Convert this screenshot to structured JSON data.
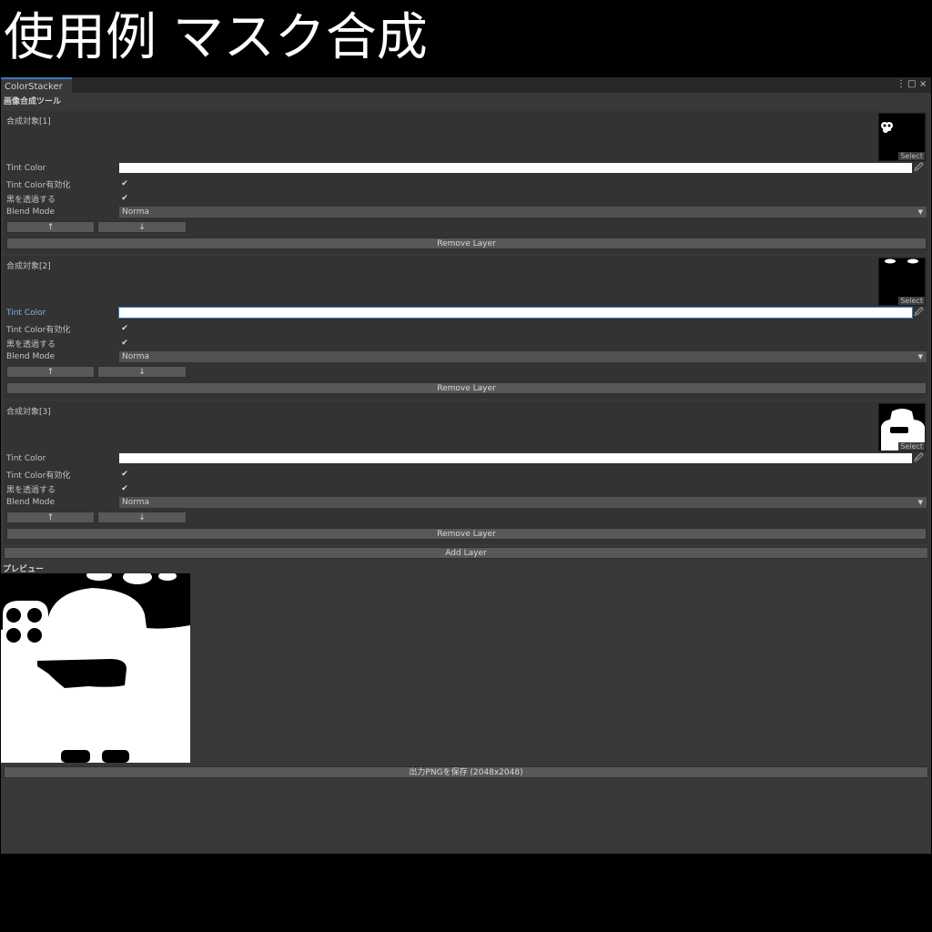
{
  "banner": {
    "title": "使用例 マスク合成"
  },
  "window": {
    "tab_label": "ColorStacker",
    "menu_icon": "⋮",
    "maximize_icon": "□",
    "close_icon": "×"
  },
  "tool_title": "画像合成ツール",
  "labels": {
    "tint_color": "Tint Color",
    "tint_enable": "Tint Color有効化",
    "black_transparent": "黒を透過する",
    "blend_mode": "Blend Mode",
    "select": "Select",
    "up": "↑",
    "down": "↓",
    "remove_layer": "Remove Layer",
    "check": "✔",
    "picker": "🖉",
    "dropdown_arrow": "▼"
  },
  "layers": [
    {
      "title": "合成対象[1]",
      "tint_color": "#ffffff",
      "tint_enabled": true,
      "black_transparent": true,
      "blend_mode": "Norma"
    },
    {
      "title": "合成対象[2]",
      "tint_color": "#ffffff",
      "tint_enabled": true,
      "black_transparent": true,
      "blend_mode": "Norma"
    },
    {
      "title": "合成対象[3]",
      "tint_color": "#ffffff",
      "tint_enabled": true,
      "black_transparent": true,
      "blend_mode": "Norma"
    }
  ],
  "add_layer_label": "Add Layer",
  "preview_label": "プレビュー",
  "save_label": "出力PNGを保存 (2048x2048)",
  "colors": {
    "accent": "#3a79bb",
    "panel": "#383838",
    "layer_bg": "#333333",
    "button": "#585858"
  }
}
